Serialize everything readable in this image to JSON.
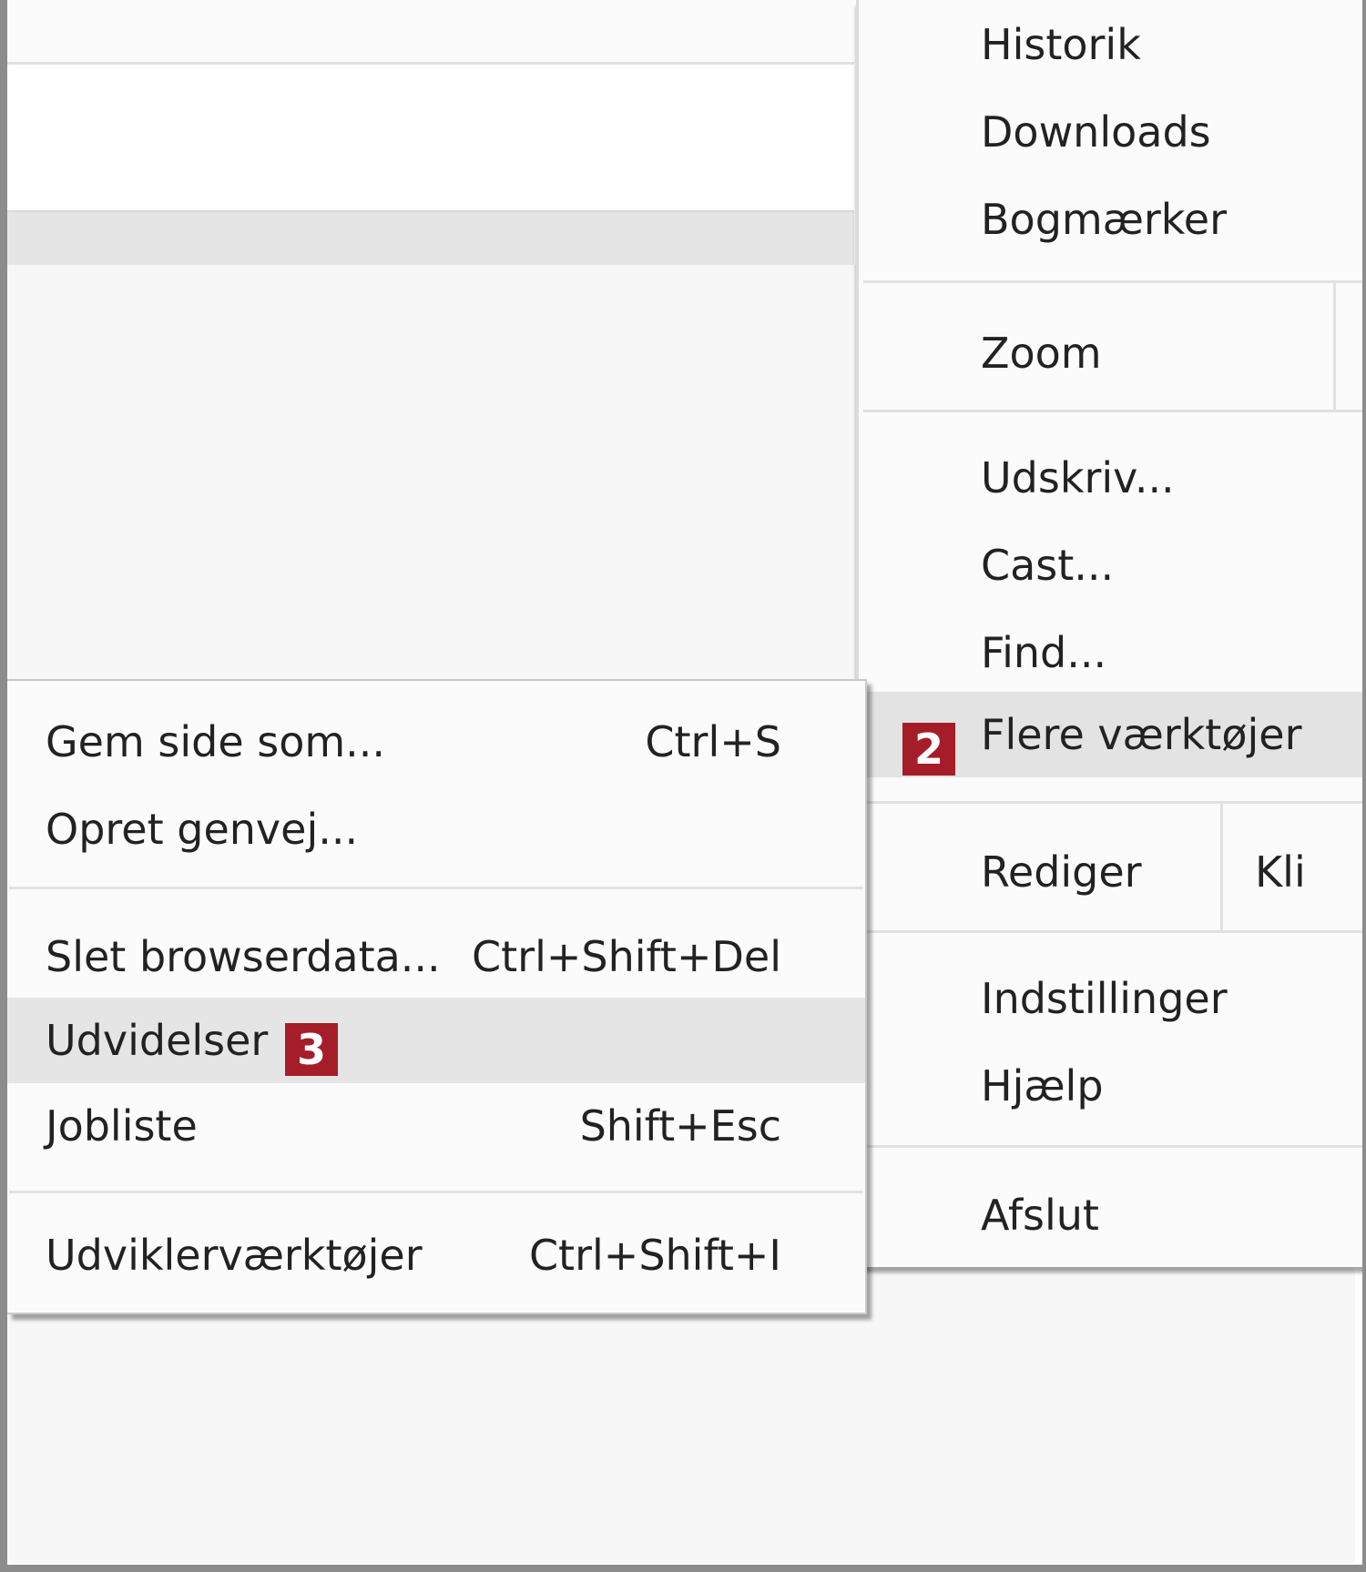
{
  "main_menu": {
    "history": "Historik",
    "downloads": "Downloads",
    "bookmarks": "Bogmærker",
    "zoom": "Zoom",
    "print": "Udskriv...",
    "cast": "Cast...",
    "find": "Find...",
    "more_tools": "Flere værktøjer",
    "more_tools_badge": "2",
    "edit": "Rediger",
    "edit_cut_partial": "Kli",
    "settings": "Indstillinger",
    "help": "Hjælp",
    "exit": "Afslut"
  },
  "submenu": {
    "items": [
      {
        "label": "Gem side som...",
        "shortcut": "Ctrl+S"
      },
      {
        "label": "Opret genvej...",
        "shortcut": ""
      },
      {
        "label": "Slet browserdata...",
        "shortcut": "Ctrl+Shift+Del"
      },
      {
        "label": "Udvidelser",
        "shortcut": "",
        "badge": "3"
      },
      {
        "label": "Jobliste",
        "shortcut": "Shift+Esc"
      },
      {
        "label": "Udviklerværktøjer",
        "shortcut": "Ctrl+Shift+I"
      }
    ]
  },
  "colors": {
    "badge": "#a51d29",
    "highlight": "#e3e3e3",
    "menu_bg": "#fbfbfb"
  }
}
